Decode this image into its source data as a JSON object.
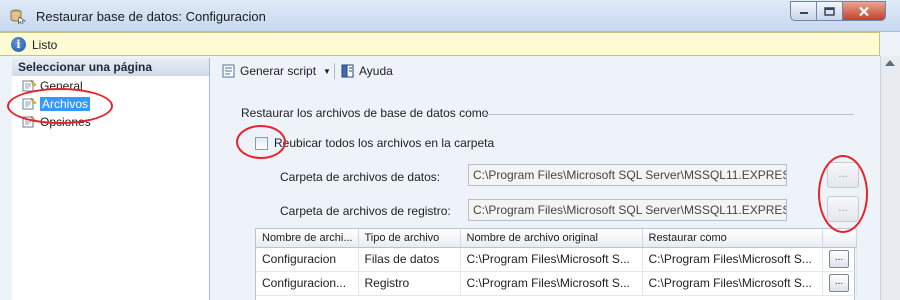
{
  "window": {
    "title": "Restaurar base de datos: Configuracion",
    "icon": "database-restore-icon"
  },
  "status": {
    "text": "Listo",
    "icon": "info-icon"
  },
  "left_pane": {
    "header": "Seleccionar una página",
    "items": [
      {
        "label": "General",
        "selected": false,
        "icon": "page-icon"
      },
      {
        "label": "Archivos",
        "selected": true,
        "icon": "page-icon"
      },
      {
        "label": "Opciones",
        "selected": false,
        "icon": "page-icon"
      }
    ]
  },
  "toolbar": {
    "script_label": "Generar script",
    "help_label": "Ayuda"
  },
  "section": {
    "title": "Restaurar los archivos de base de datos como"
  },
  "relocate": {
    "label": "Reubicar todos los archivos en la carpeta",
    "checked": false
  },
  "fields": {
    "data_folder_label": "Carpeta de archivos de datos:",
    "data_folder_value": "C:\\Program Files\\Microsoft SQL Server\\MSSQL11.EXPRESS\\I",
    "log_folder_label": "Carpeta de archivos de registro:",
    "log_folder_value": "C:\\Program Files\\Microsoft SQL Server\\MSSQL11.EXPRESS\\I",
    "browse_label": "..."
  },
  "grid": {
    "headers": [
      "Nombre de archi...",
      "Tipo de archivo",
      "Nombre de archivo original",
      "Restaurar como"
    ],
    "rows": [
      [
        "Configuracion",
        "Filas de datos",
        "C:\\Program Files\\Microsoft S...",
        "C:\\Program Files\\Microsoft S..."
      ],
      [
        "Configuracion...",
        "Registro",
        "C:\\Program Files\\Microsoft S...",
        "C:\\Program Files\\Microsoft S..."
      ]
    ],
    "row_button_label": "..."
  },
  "colors": {
    "selection": "#3399ff",
    "annotation": "#e8232a",
    "status_bg": "#fdfbd3"
  }
}
